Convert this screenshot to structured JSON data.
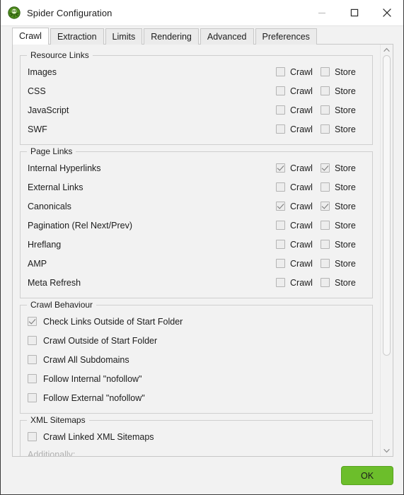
{
  "window": {
    "title": "Spider Configuration",
    "icon": "spider-icon",
    "minimize_label": "Minimize",
    "maximize_label": "Maximize",
    "close_label": "Close"
  },
  "tabs": [
    {
      "label": "Crawl",
      "active": true
    },
    {
      "label": "Extraction",
      "active": false
    },
    {
      "label": "Limits",
      "active": false
    },
    {
      "label": "Rendering",
      "active": false
    },
    {
      "label": "Advanced",
      "active": false
    },
    {
      "label": "Preferences",
      "active": false
    }
  ],
  "columns": {
    "crawl": "Crawl",
    "store": "Store"
  },
  "groups": {
    "resource_links": {
      "legend": "Resource Links",
      "rows": [
        {
          "label": "Images",
          "crawl": false,
          "store": false
        },
        {
          "label": "CSS",
          "crawl": false,
          "store": false
        },
        {
          "label": "JavaScript",
          "crawl": false,
          "store": false
        },
        {
          "label": "SWF",
          "crawl": false,
          "store": false
        }
      ]
    },
    "page_links": {
      "legend": "Page Links",
      "rows": [
        {
          "label": "Internal Hyperlinks",
          "crawl": true,
          "store": true
        },
        {
          "label": "External Links",
          "crawl": false,
          "store": false
        },
        {
          "label": "Canonicals",
          "crawl": true,
          "store": true
        },
        {
          "label": "Pagination (Rel Next/Prev)",
          "crawl": false,
          "store": false
        },
        {
          "label": "Hreflang",
          "crawl": false,
          "store": false
        },
        {
          "label": "AMP",
          "crawl": false,
          "store": false
        },
        {
          "label": "Meta Refresh",
          "crawl": false,
          "store": false
        }
      ]
    },
    "crawl_behaviour": {
      "legend": "Crawl Behaviour",
      "rows": [
        {
          "label": "Check Links Outside of Start Folder",
          "checked": true
        },
        {
          "label": "Crawl Outside of Start Folder",
          "checked": false
        },
        {
          "label": "Crawl All Subdomains",
          "checked": false
        },
        {
          "label": "Follow Internal \"nofollow\"",
          "checked": false
        },
        {
          "label": "Follow External \"nofollow\"",
          "checked": false
        }
      ]
    },
    "xml_sitemaps": {
      "legend": "XML Sitemaps",
      "rows": [
        {
          "label": "Crawl Linked XML Sitemaps",
          "checked": false
        }
      ],
      "additionally_label": "Additionally:"
    }
  },
  "footer": {
    "ok_label": "OK"
  },
  "colors": {
    "accent_green": "#6cbe2b",
    "accent_green_border": "#58a31f",
    "window_background": "#f2f2f2",
    "titlebar_background": "#ffffff",
    "active_tab_background": "#ffffff",
    "disabled_text": "#b0b0b0"
  }
}
